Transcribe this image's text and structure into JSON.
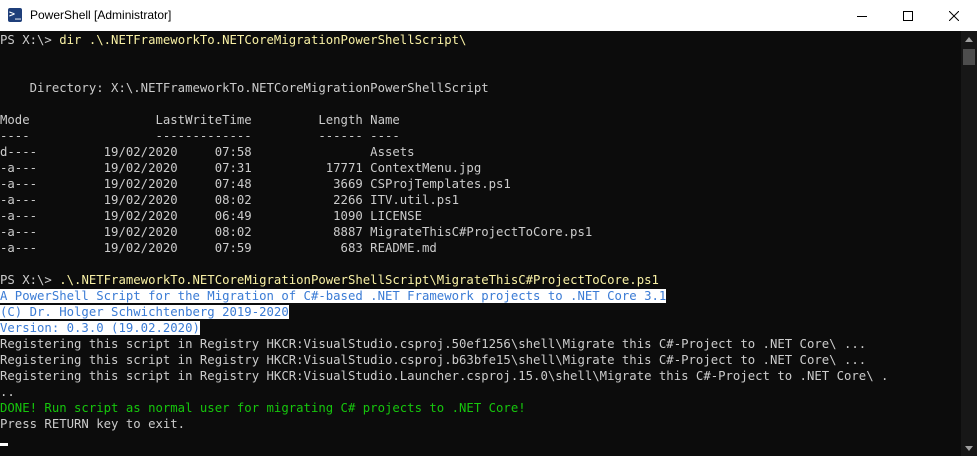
{
  "window": {
    "title": "PowerShell [Administrator]"
  },
  "lines": {
    "l0": {
      "prompt": "PS X:\\> ",
      "cmd": "dir .\\.NETFrameworkTo.NETCoreMigrationPowerShellScript\\"
    },
    "l3": "    Directory: X:\\.NETFrameworkTo.NETCoreMigrationPowerShellScript",
    "l5": "Mode                 LastWriteTime         Length Name",
    "l6": "----                 -------------         ------ ----",
    "l7": "d----         19/02/2020     07:58                Assets",
    "l8": "-a---         19/02/2020     07:31          17771 ContextMenu.jpg",
    "l9": "-a---         19/02/2020     07:48           3669 CSProjTemplates.ps1",
    "l10": "-a---         19/02/2020     08:02           2266 ITV.util.ps1",
    "l11": "-a---         19/02/2020     06:49           1090 LICENSE",
    "l12": "-a---         19/02/2020     08:02           8887 MigrateThisC#ProjectToCore.ps1",
    "l13": "-a---         19/02/2020     07:59            683 README.md",
    "l15": {
      "prompt": "PS X:\\> ",
      "cmd": ".\\.NETFrameworkTo.NETCoreMigrationPowerShellScript\\MigrateThisC#ProjectToCore.ps1"
    },
    "l16": "A PowerShell Script for the Migration of C#-based .NET Framework projects to .NET Core 3.1",
    "l17": "(C) Dr. Holger Schwichtenberg 2019-2020",
    "l18": "Version: 0.3.0 (19.02.2020)",
    "l19": "Registering this script in Registry HKCR:VisualStudio.csproj.50ef1256\\shell\\Migrate this C#-Project to .NET Core\\ ...",
    "l20": "Registering this script in Registry HKCR:VisualStudio.csproj.b63bfe15\\shell\\Migrate this C#-Project to .NET Core\\ ...",
    "l21": "Registering this script in Registry HKCR:VisualStudio.Launcher.csproj.15.0\\shell\\Migrate this C#-Project to .NET Core\\ .",
    "l22": "..",
    "l23": "DONE! Run script as normal user for migrating C# projects to .NET Core!",
    "l24": "Press RETURN key to exit."
  },
  "colors": {
    "background": "#0c0c0c",
    "foreground": "#cccccc",
    "command": "#f9f1a5",
    "selection_text": "#3a7bd5",
    "success": "#16c60c"
  },
  "icons": {
    "app": "powershell-icon",
    "minimize": "minimize-icon",
    "maximize": "maximize-icon",
    "close": "close-icon"
  }
}
